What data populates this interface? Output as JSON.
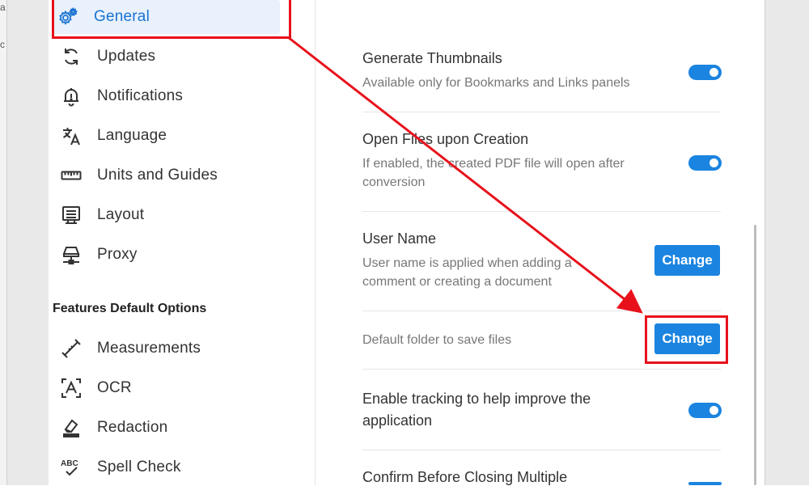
{
  "background": {
    "left_fragment_top": "a",
    "left_fragment_mid": "c"
  },
  "sidebar": {
    "items": [
      {
        "label": "General",
        "icon": "gear-icon",
        "active": true
      },
      {
        "label": "Updates",
        "icon": "sync-icon"
      },
      {
        "label": "Notifications",
        "icon": "bell-icon"
      },
      {
        "label": "Language",
        "icon": "translate-icon"
      },
      {
        "label": "Units and Guides",
        "icon": "ruler-icon"
      },
      {
        "label": "Layout",
        "icon": "layout-icon"
      },
      {
        "label": "Proxy",
        "icon": "network-icon"
      }
    ],
    "section_title": "Features Default Options",
    "feature_items": [
      {
        "label": "Measurements",
        "icon": "measure-icon"
      },
      {
        "label": "OCR",
        "icon": "ocr-icon"
      },
      {
        "label": "Redaction",
        "icon": "eraser-icon"
      },
      {
        "label": "Spell Check",
        "icon": "spellcheck-icon"
      }
    ]
  },
  "settings": {
    "thumbnails": {
      "title": "Generate Thumbnails",
      "desc": "Available only for Bookmarks and Links panels",
      "enabled": true
    },
    "open_files": {
      "title": "Open Files upon Creation",
      "desc_line1": "If enabled, the created PDF file will open after",
      "desc_line2": "conversion",
      "enabled": true
    },
    "user_name": {
      "title": "User Name",
      "desc_line1": "User name is applied when adding a",
      "desc_line2": "comment or creating a document",
      "button": "Change"
    },
    "default_folder": {
      "desc": "Default folder to save files",
      "button": "Change"
    },
    "tracking": {
      "title_line1": "Enable tracking to help improve the",
      "title_line2": "application",
      "enabled": true
    },
    "confirm_close": {
      "title": "Confirm Before Closing Multiple"
    }
  },
  "annotation": {
    "color": "#e8111b"
  },
  "colors": {
    "accent": "#1a84e0",
    "active_bg": "#e8f1fc",
    "active_text": "#1a73d1"
  }
}
